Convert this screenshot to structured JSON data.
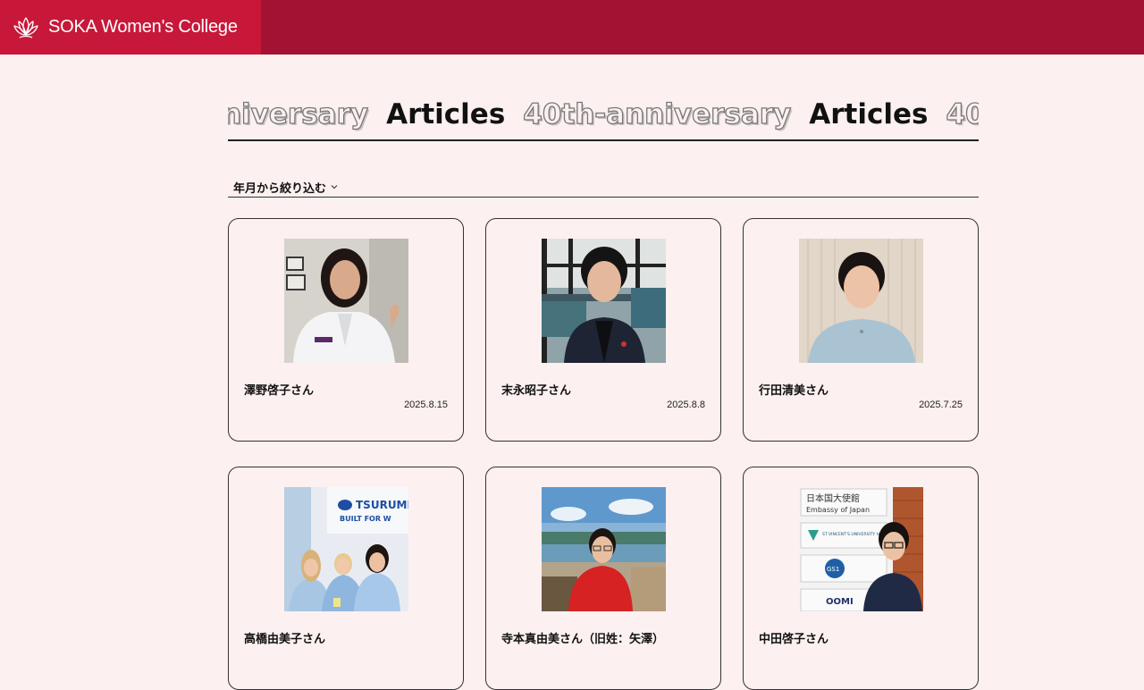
{
  "header": {
    "brand": "SOKA Women's College",
    "logo_icon": "lotus-icon",
    "accent": "#a31233",
    "brand_bg": "#c8183a"
  },
  "title_marquee": {
    "words": [
      "anniversary",
      "Articles",
      "40th-anniversary",
      "Articles"
    ]
  },
  "filter": {
    "label": "年月から絞り込む",
    "icon": "chevron-down-icon"
  },
  "articles": [
    {
      "name": "澤野啓子さん",
      "date": "2025.8.15"
    },
    {
      "name": "末永昭子さん",
      "date": "2025.8.8"
    },
    {
      "name": "行田清美さん",
      "date": "2025.7.25"
    },
    {
      "name": "高橋由美子さん",
      "date": ""
    },
    {
      "name": "寺本真由美さん（旧姓：矢澤）",
      "date": ""
    },
    {
      "name": "中田啓子さん",
      "date": ""
    }
  ],
  "photo_signage": {
    "company": "TSURUMI P",
    "slogan": "BUILT FOR W",
    "embassy_jp": "日本国大使館",
    "embassy_en": "Embassy of Japan",
    "hospital": "ST VINCENT'S UNIVERSITY HOSPITAL",
    "gs1": "GS1",
    "oomi": "OOMI"
  }
}
